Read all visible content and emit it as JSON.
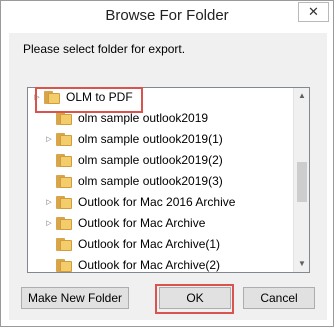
{
  "window": {
    "title": "Browse For Folder",
    "close_glyph": "✕"
  },
  "dialog": {
    "prompt": "Please select folder for export."
  },
  "tree": {
    "items": [
      {
        "label": "OLM to PDF",
        "expandable": true,
        "selected": true
      },
      {
        "label": "olm sample outlook2019",
        "expandable": false
      },
      {
        "label": "olm sample outlook2019(1)",
        "expandable": true
      },
      {
        "label": "olm sample outlook2019(2)",
        "expandable": false
      },
      {
        "label": "olm sample outlook2019(3)",
        "expandable": false
      },
      {
        "label": "Outlook for Mac 2016 Archive",
        "expandable": true
      },
      {
        "label": "Outlook for Mac Archive",
        "expandable": true
      },
      {
        "label": "Outlook for Mac Archive(1)",
        "expandable": false
      },
      {
        "label": "Outlook for Mac Archive(2)",
        "expandable": false
      }
    ]
  },
  "buttons": {
    "new_folder": "Make New Folder",
    "ok": "OK",
    "cancel": "Cancel"
  },
  "colors": {
    "highlight": "#d9534f",
    "folder": "#f3cc6b"
  }
}
